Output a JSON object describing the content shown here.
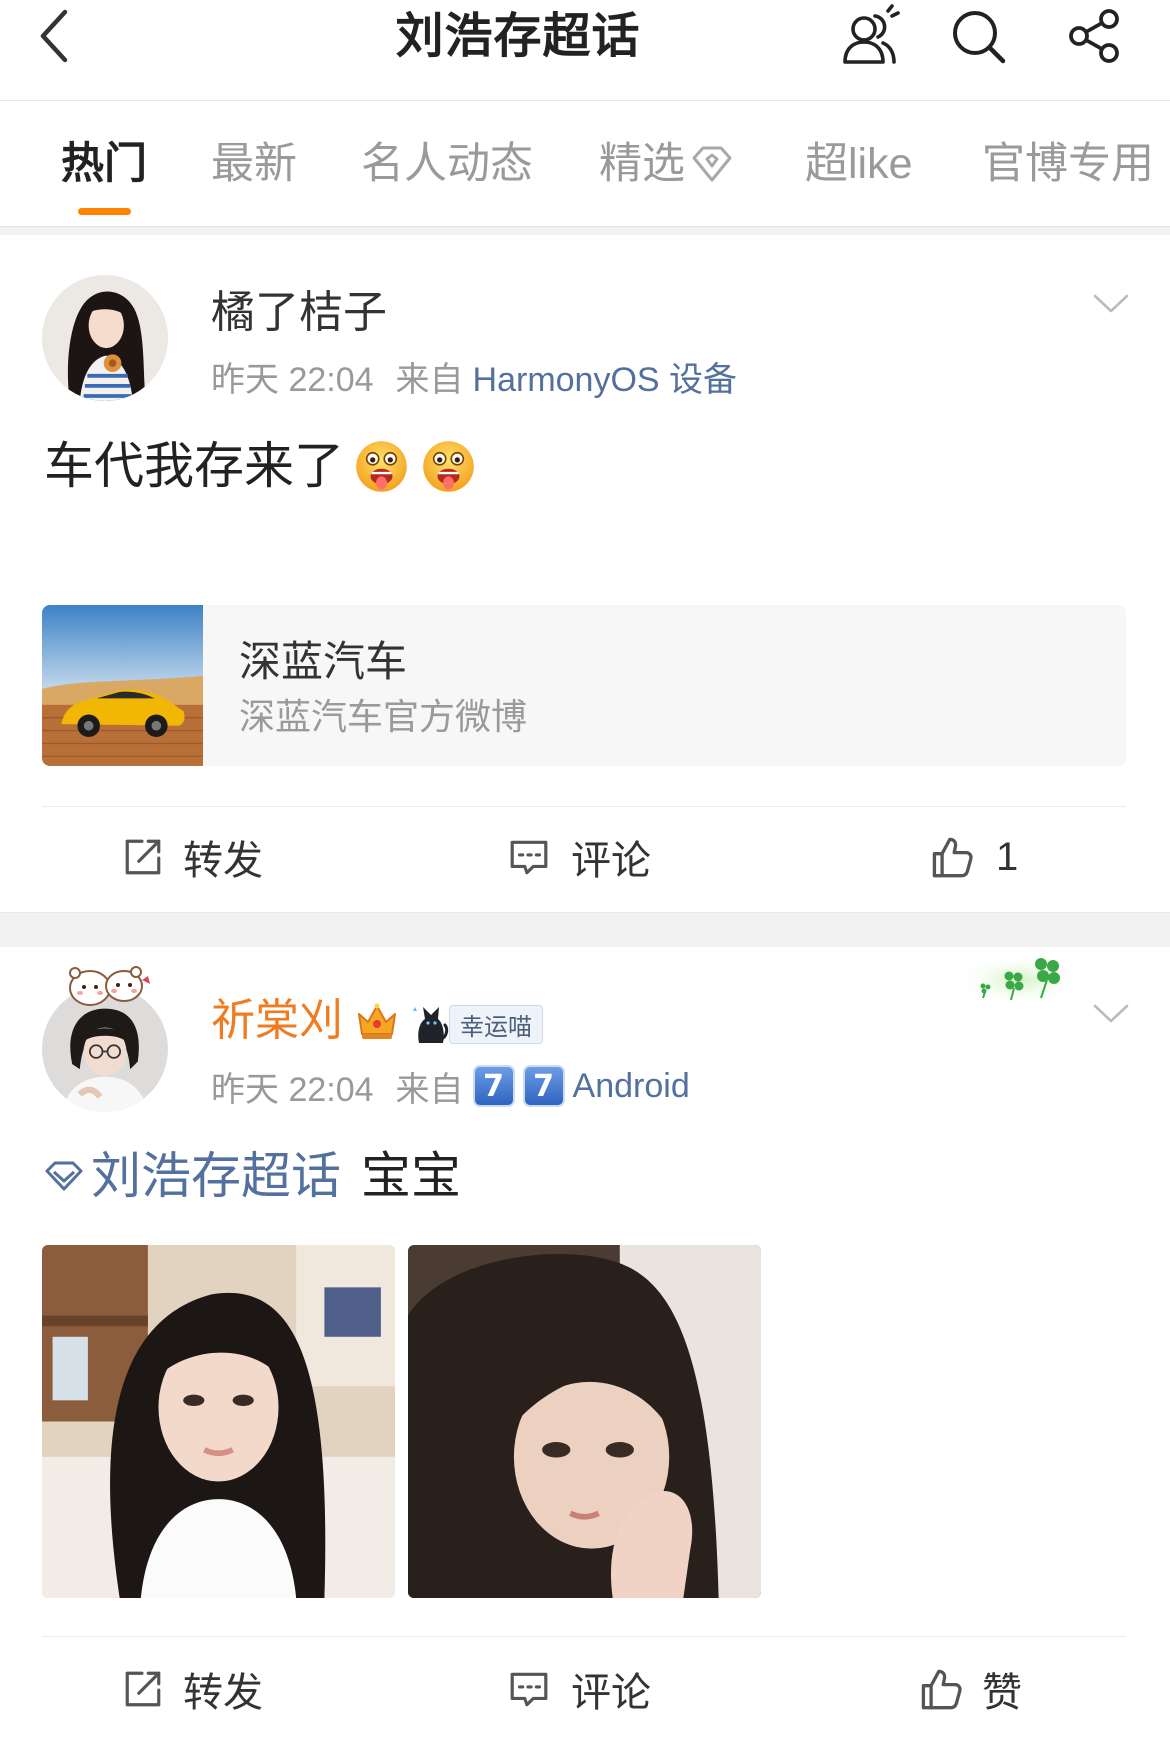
{
  "header": {
    "title": "刘浩存超话",
    "icons": [
      "back-arrow-icon",
      "followers-icon",
      "search-icon",
      "share-icon"
    ]
  },
  "tabs": [
    {
      "label": "热门",
      "active": true
    },
    {
      "label": "最新"
    },
    {
      "label": "名人动态"
    },
    {
      "label": "精选",
      "icon": "featured-diamond-icon"
    },
    {
      "label": "超like"
    },
    {
      "label": "官博专用"
    }
  ],
  "colors": {
    "accent": "#FF8200",
    "link": "#53709E",
    "vip_name": "#F07C22",
    "text": "#222222",
    "muted": "#999999"
  },
  "posts": [
    {
      "author": "橘了桔子",
      "time": "昨天 22:04",
      "source_prefix": "来自",
      "source": "HarmonyOS 设备",
      "text": "车代我存来了",
      "emojis": [
        "drooling-face-emoji",
        "drooling-face-emoji"
      ],
      "card": {
        "title": "深蓝汽车",
        "subtitle": "深蓝汽车官方微博"
      },
      "actions": {
        "repost": "转发",
        "comment": "评论",
        "like": "1"
      }
    },
    {
      "author": "祈棠刈",
      "author_icons": [
        "crown-icon",
        "lucky-cat-icon"
      ],
      "badge": "幸运喵",
      "time": "昨天 22:04",
      "source_prefix": "来自",
      "source_keycaps": [
        "7",
        "7"
      ],
      "source": "Android",
      "topic": "刘浩存超话",
      "text": "宝宝",
      "actions": {
        "repost": "转发",
        "comment": "评论",
        "like": "赞"
      }
    }
  ]
}
